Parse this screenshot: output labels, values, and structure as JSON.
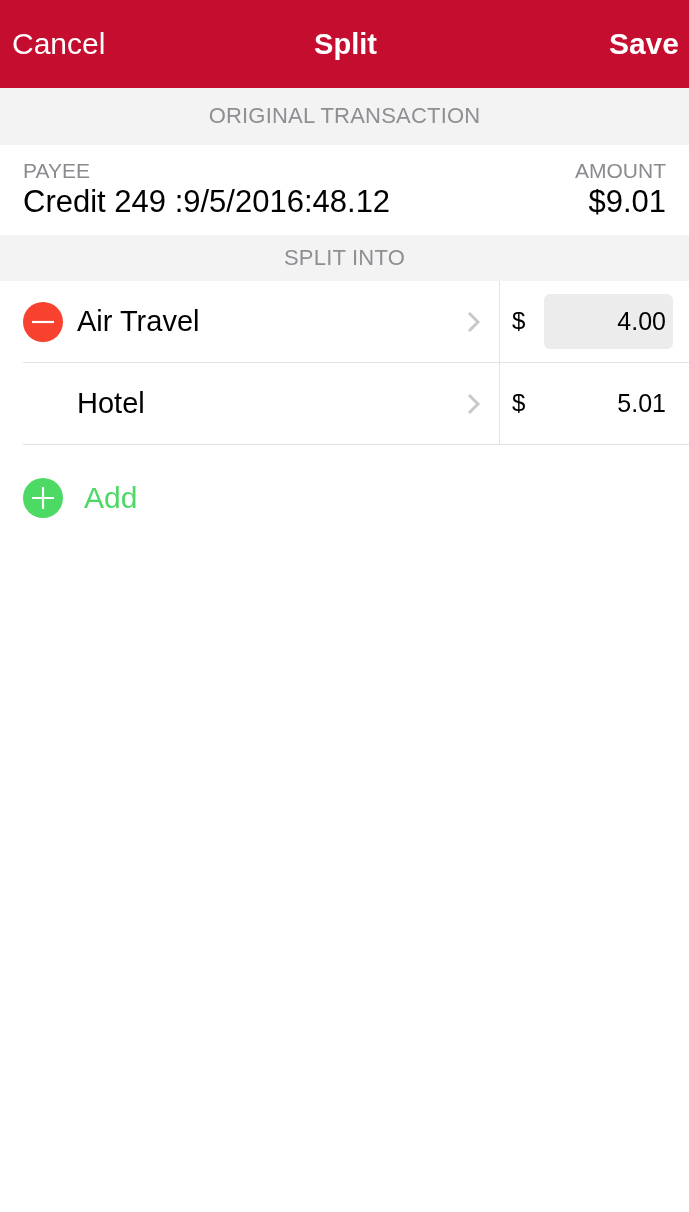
{
  "nav": {
    "cancel": "Cancel",
    "title": "Split",
    "save": "Save"
  },
  "original_section": {
    "header": "ORIGINAL TRANSACTION",
    "payee_label": "PAYEE",
    "payee": "Credit 249 :9/5/2016:48.12",
    "amount_label": "AMOUNT",
    "amount": "$9.01"
  },
  "split_section": {
    "header": "SPLIT INTO",
    "splits": [
      {
        "category": "Air Travel",
        "currency": "$",
        "amount": "4.00",
        "delete_button": true,
        "focused": true
      },
      {
        "category": "Hotel",
        "currency": "$",
        "amount": "5.01",
        "delete_button": false,
        "focused": false
      }
    ],
    "add_label": "Add"
  }
}
